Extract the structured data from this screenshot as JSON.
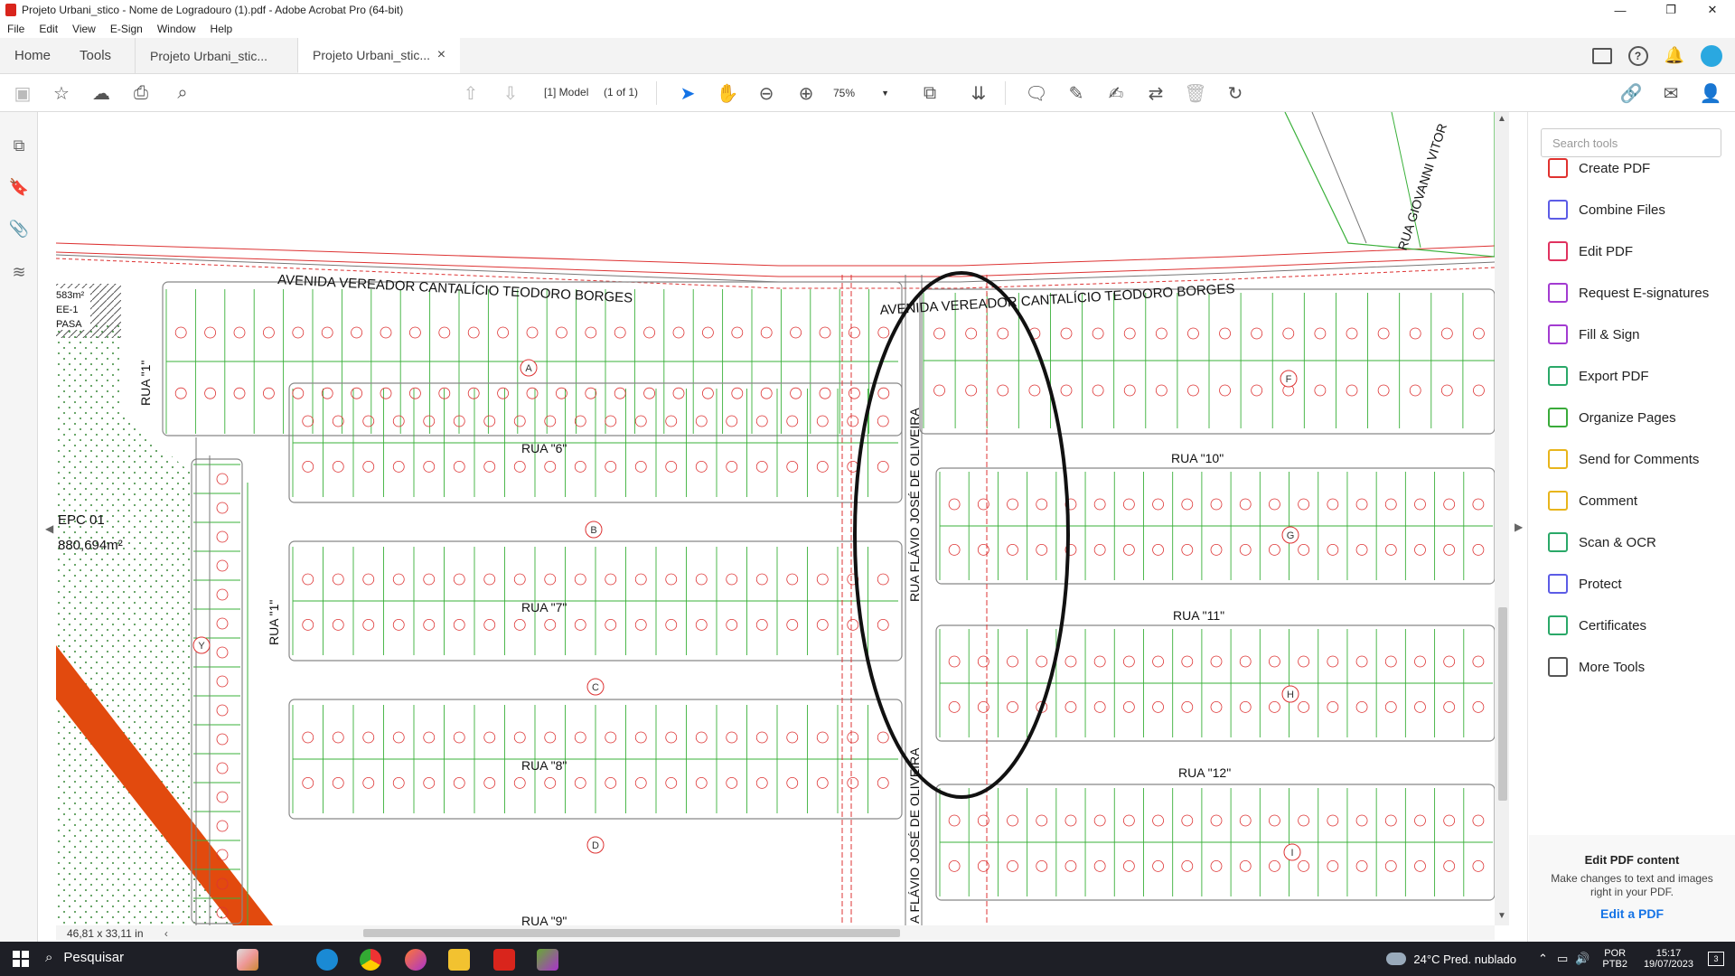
{
  "window": {
    "title": "Projeto Urbani_stico - Nome de Logradouro (1).pdf - Adobe Acrobat Pro (64-bit)",
    "controls": [
      "—",
      "❐",
      "✕"
    ]
  },
  "menu": [
    "File",
    "Edit",
    "View",
    "E-Sign",
    "Window",
    "Help"
  ],
  "tabs": {
    "home": "Home",
    "tools": "Tools",
    "docs": [
      {
        "label": "Projeto Urbani_stic...",
        "active": false
      },
      {
        "label": "Projeto Urbani_stic...",
        "active": true,
        "close": "×"
      }
    ]
  },
  "toolbar": {
    "page_label": "[1] Model",
    "page_count": "(1 of 1)",
    "zoom": "75%"
  },
  "document": {
    "streets": {
      "avenida_west": "AVENIDA VEREADOR CANTALÍCIO TEODORO BORGES",
      "avenida_east": "AVENIDA VEREADOR CANTALÍCIO TEODORO BORGES",
      "rua_giovanni": "RUA GIOVANNI VITOR",
      "rua_1_upper": "RUA \"1\"",
      "rua_1_lower": "RUA \"1\"",
      "rua_6": "RUA \"6\"",
      "rua_7": "RUA \"7\"",
      "rua_8": "RUA \"8\"",
      "rua_9": "RUA \"9\"",
      "rua_10": "RUA \"10\"",
      "rua_11": "RUA \"11\"",
      "rua_12": "RUA \"12\"",
      "rua_flavio_upper": "RUA FLÁVIO JOSÉ DE OLIVEIRA",
      "rua_flavio_lower": "A FLÁVIO JOSÉ DE OLIVEIRA"
    },
    "area_labels": {
      "epc": "EPC 01",
      "epc_area": "880,694m²",
      "ee_area": "583m²",
      "ee": "EE-1",
      "ee_type": "PASA"
    },
    "block_letters": [
      "A",
      "B",
      "C",
      "D",
      "F",
      "G",
      "H",
      "I",
      "Y"
    ]
  },
  "scroll": {
    "page_size": "46,81 x 33,11 in"
  },
  "tools_pane": {
    "search_placeholder": "Search tools",
    "items": [
      {
        "label": "Create PDF",
        "color": "#e0322f"
      },
      {
        "label": "Combine Files",
        "color": "#5c5ce6"
      },
      {
        "label": "Edit PDF",
        "color": "#e0325f"
      },
      {
        "label": "Request E-signatures",
        "color": "#a33bd1"
      },
      {
        "label": "Fill & Sign",
        "color": "#a33bd1"
      },
      {
        "label": "Export PDF",
        "color": "#2aa868"
      },
      {
        "label": "Organize Pages",
        "color": "#3aab3a"
      },
      {
        "label": "Send for Comments",
        "color": "#e8b51c"
      },
      {
        "label": "Comment",
        "color": "#e8b51c"
      },
      {
        "label": "Scan & OCR",
        "color": "#2aa868"
      },
      {
        "label": "Protect",
        "color": "#5c5ce6"
      },
      {
        "label": "Certificates",
        "color": "#2aa868"
      },
      {
        "label": "More Tools",
        "color": "#555555"
      }
    ],
    "promo": {
      "title": "Edit PDF content",
      "desc": "Make changes to text and images right in your PDF.",
      "link": "Edit a PDF"
    }
  },
  "taskbar": {
    "search": "Pesquisar",
    "weather": "24°C  Pred. nublado",
    "lang": "POR",
    "layout": "PTB2",
    "time": "15:17",
    "date": "19/07/2023",
    "badge": "3"
  }
}
